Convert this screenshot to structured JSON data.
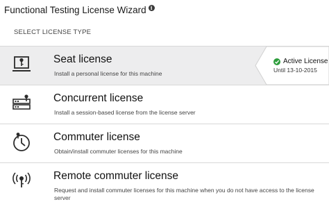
{
  "window": {
    "title": "Functional Testing License Wizard",
    "info_icon": "info-icon"
  },
  "section_label": "SELECT LICENSE TYPE",
  "items": [
    {
      "title": "Seat license",
      "description": "Install a personal license for this machine",
      "icon": "laptop-key-icon",
      "selected": true
    },
    {
      "title": "Concurrent license",
      "description": "Install a session-based license from the license server",
      "icon": "server-key-icon",
      "selected": false
    },
    {
      "title": "Commuter license",
      "description": "Obtain/install commuter licenses for this machine",
      "icon": "clock-key-icon",
      "selected": false
    },
    {
      "title": "Remote commuter license",
      "description": "Request and install commuter licenses for this machine when you do not have access to the license server",
      "icon": "wireless-key-icon",
      "selected": false
    }
  ],
  "active_badge": {
    "status": "Active License",
    "until": "Until 13-10-2015",
    "status_color": "#2e9d3c"
  }
}
